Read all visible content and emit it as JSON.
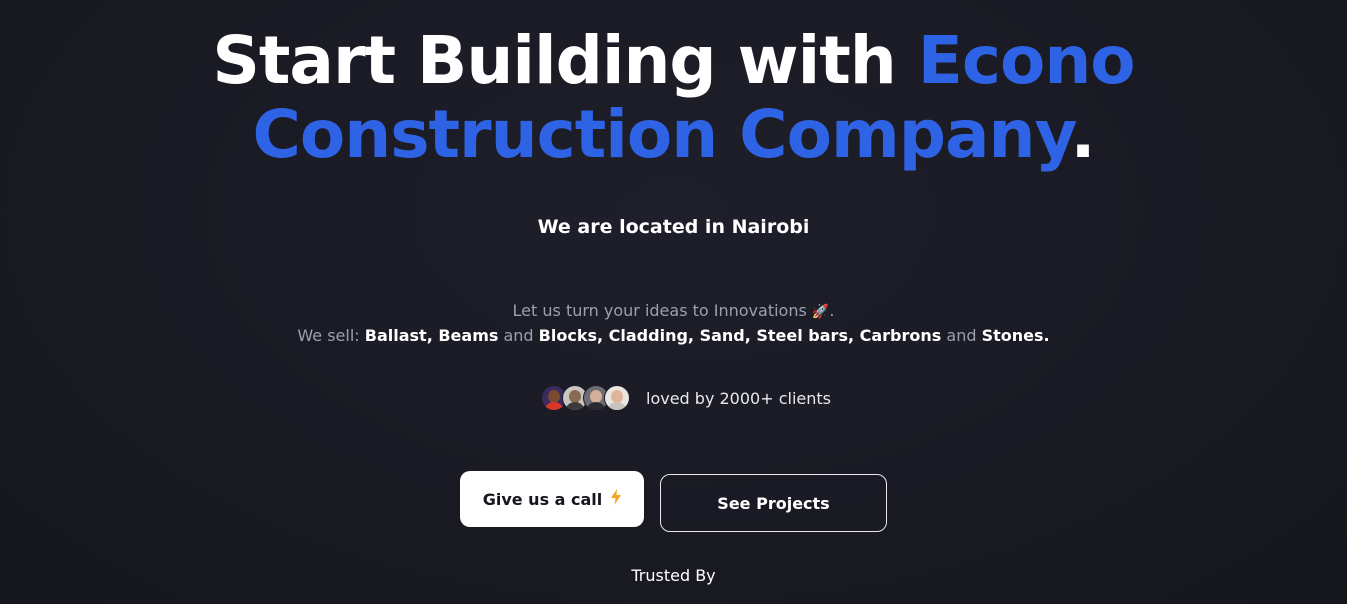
{
  "hero": {
    "title_part1": "Start Building with ",
    "title_accent": "Econo Construction Company",
    "title_period": "."
  },
  "location": "We are located in Nairobi",
  "lead": {
    "line1_text": "Let us turn your ideas to Innovations",
    "line1_icon": "rocket-icon",
    "line1_end": ".",
    "line2_prefix": "We sell: ",
    "item1": "Ballast, Beams",
    "and1": " and ",
    "item2": "Blocks",
    "comma": ", ",
    "item3": "Cladding, Sand, Steel bars, Carbrons",
    "and2": " and ",
    "item4": "Stones."
  },
  "clients": {
    "text": "loved by 2000+ clients"
  },
  "buttons": {
    "call_label": "Give us a call",
    "call_icon": "lightning-icon",
    "projects_label": "See Projects"
  },
  "trusted_label": "Trusted By",
  "colors": {
    "accent": "#2f63e6",
    "background": "#1b1b25",
    "muted_text": "#9aa0ad",
    "bolt": "#f5a623"
  }
}
